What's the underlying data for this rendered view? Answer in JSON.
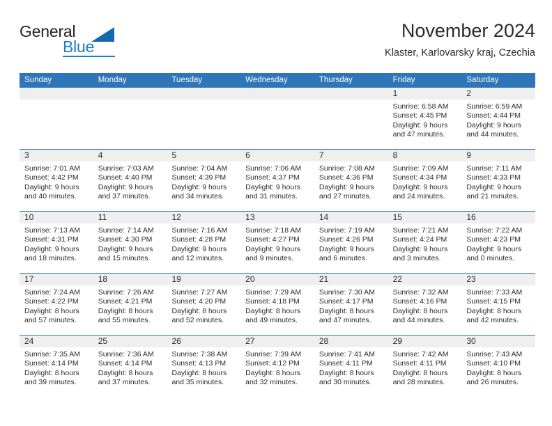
{
  "brand": {
    "word_one": "General",
    "word_two": "Blue",
    "triangle_icon": "triangle-icon",
    "accent_color": "#1c7cc4"
  },
  "header": {
    "title": "November 2024",
    "subtitle": "Klaster, Karlovarsky kraj, Czechia"
  },
  "theme": {
    "header_blue": "#2f76b8",
    "day_band_gray": "#efefef",
    "text": "#2b2b2b"
  },
  "weekdays": [
    "Sunday",
    "Monday",
    "Tuesday",
    "Wednesday",
    "Thursday",
    "Friday",
    "Saturday"
  ],
  "weeks": [
    [
      {
        "day": "",
        "empty": true,
        "sunrise": "",
        "sunset": "",
        "daylight_1": "",
        "daylight_2": ""
      },
      {
        "day": "",
        "empty": true,
        "sunrise": "",
        "sunset": "",
        "daylight_1": "",
        "daylight_2": ""
      },
      {
        "day": "",
        "empty": true,
        "sunrise": "",
        "sunset": "",
        "daylight_1": "",
        "daylight_2": ""
      },
      {
        "day": "",
        "empty": true,
        "sunrise": "",
        "sunset": "",
        "daylight_1": "",
        "daylight_2": ""
      },
      {
        "day": "",
        "empty": true,
        "sunrise": "",
        "sunset": "",
        "daylight_1": "",
        "daylight_2": ""
      },
      {
        "day": "1",
        "empty": false,
        "sunrise": "Sunrise: 6:58 AM",
        "sunset": "Sunset: 4:45 PM",
        "daylight_1": "Daylight: 9 hours",
        "daylight_2": "and 47 minutes."
      },
      {
        "day": "2",
        "empty": false,
        "sunrise": "Sunrise: 6:59 AM",
        "sunset": "Sunset: 4:44 PM",
        "daylight_1": "Daylight: 9 hours",
        "daylight_2": "and 44 minutes."
      }
    ],
    [
      {
        "day": "3",
        "empty": false,
        "sunrise": "Sunrise: 7:01 AM",
        "sunset": "Sunset: 4:42 PM",
        "daylight_1": "Daylight: 9 hours",
        "daylight_2": "and 40 minutes."
      },
      {
        "day": "4",
        "empty": false,
        "sunrise": "Sunrise: 7:03 AM",
        "sunset": "Sunset: 4:40 PM",
        "daylight_1": "Daylight: 9 hours",
        "daylight_2": "and 37 minutes."
      },
      {
        "day": "5",
        "empty": false,
        "sunrise": "Sunrise: 7:04 AM",
        "sunset": "Sunset: 4:39 PM",
        "daylight_1": "Daylight: 9 hours",
        "daylight_2": "and 34 minutes."
      },
      {
        "day": "6",
        "empty": false,
        "sunrise": "Sunrise: 7:06 AM",
        "sunset": "Sunset: 4:37 PM",
        "daylight_1": "Daylight: 9 hours",
        "daylight_2": "and 31 minutes."
      },
      {
        "day": "7",
        "empty": false,
        "sunrise": "Sunrise: 7:08 AM",
        "sunset": "Sunset: 4:36 PM",
        "daylight_1": "Daylight: 9 hours",
        "daylight_2": "and 27 minutes."
      },
      {
        "day": "8",
        "empty": false,
        "sunrise": "Sunrise: 7:09 AM",
        "sunset": "Sunset: 4:34 PM",
        "daylight_1": "Daylight: 9 hours",
        "daylight_2": "and 24 minutes."
      },
      {
        "day": "9",
        "empty": false,
        "sunrise": "Sunrise: 7:11 AM",
        "sunset": "Sunset: 4:33 PM",
        "daylight_1": "Daylight: 9 hours",
        "daylight_2": "and 21 minutes."
      }
    ],
    [
      {
        "day": "10",
        "empty": false,
        "sunrise": "Sunrise: 7:13 AM",
        "sunset": "Sunset: 4:31 PM",
        "daylight_1": "Daylight: 9 hours",
        "daylight_2": "and 18 minutes."
      },
      {
        "day": "11",
        "empty": false,
        "sunrise": "Sunrise: 7:14 AM",
        "sunset": "Sunset: 4:30 PM",
        "daylight_1": "Daylight: 9 hours",
        "daylight_2": "and 15 minutes."
      },
      {
        "day": "12",
        "empty": false,
        "sunrise": "Sunrise: 7:16 AM",
        "sunset": "Sunset: 4:28 PM",
        "daylight_1": "Daylight: 9 hours",
        "daylight_2": "and 12 minutes."
      },
      {
        "day": "13",
        "empty": false,
        "sunrise": "Sunrise: 7:18 AM",
        "sunset": "Sunset: 4:27 PM",
        "daylight_1": "Daylight: 9 hours",
        "daylight_2": "and 9 minutes."
      },
      {
        "day": "14",
        "empty": false,
        "sunrise": "Sunrise: 7:19 AM",
        "sunset": "Sunset: 4:26 PM",
        "daylight_1": "Daylight: 9 hours",
        "daylight_2": "and 6 minutes."
      },
      {
        "day": "15",
        "empty": false,
        "sunrise": "Sunrise: 7:21 AM",
        "sunset": "Sunset: 4:24 PM",
        "daylight_1": "Daylight: 9 hours",
        "daylight_2": "and 3 minutes."
      },
      {
        "day": "16",
        "empty": false,
        "sunrise": "Sunrise: 7:22 AM",
        "sunset": "Sunset: 4:23 PM",
        "daylight_1": "Daylight: 9 hours",
        "daylight_2": "and 0 minutes."
      }
    ],
    [
      {
        "day": "17",
        "empty": false,
        "sunrise": "Sunrise: 7:24 AM",
        "sunset": "Sunset: 4:22 PM",
        "daylight_1": "Daylight: 8 hours",
        "daylight_2": "and 57 minutes."
      },
      {
        "day": "18",
        "empty": false,
        "sunrise": "Sunrise: 7:26 AM",
        "sunset": "Sunset: 4:21 PM",
        "daylight_1": "Daylight: 8 hours",
        "daylight_2": "and 55 minutes."
      },
      {
        "day": "19",
        "empty": false,
        "sunrise": "Sunrise: 7:27 AM",
        "sunset": "Sunset: 4:20 PM",
        "daylight_1": "Daylight: 8 hours",
        "daylight_2": "and 52 minutes."
      },
      {
        "day": "20",
        "empty": false,
        "sunrise": "Sunrise: 7:29 AM",
        "sunset": "Sunset: 4:18 PM",
        "daylight_1": "Daylight: 8 hours",
        "daylight_2": "and 49 minutes."
      },
      {
        "day": "21",
        "empty": false,
        "sunrise": "Sunrise: 7:30 AM",
        "sunset": "Sunset: 4:17 PM",
        "daylight_1": "Daylight: 8 hours",
        "daylight_2": "and 47 minutes."
      },
      {
        "day": "22",
        "empty": false,
        "sunrise": "Sunrise: 7:32 AM",
        "sunset": "Sunset: 4:16 PM",
        "daylight_1": "Daylight: 8 hours",
        "daylight_2": "and 44 minutes."
      },
      {
        "day": "23",
        "empty": false,
        "sunrise": "Sunrise: 7:33 AM",
        "sunset": "Sunset: 4:15 PM",
        "daylight_1": "Daylight: 8 hours",
        "daylight_2": "and 42 minutes."
      }
    ],
    [
      {
        "day": "24",
        "empty": false,
        "sunrise": "Sunrise: 7:35 AM",
        "sunset": "Sunset: 4:14 PM",
        "daylight_1": "Daylight: 8 hours",
        "daylight_2": "and 39 minutes."
      },
      {
        "day": "25",
        "empty": false,
        "sunrise": "Sunrise: 7:36 AM",
        "sunset": "Sunset: 4:14 PM",
        "daylight_1": "Daylight: 8 hours",
        "daylight_2": "and 37 minutes."
      },
      {
        "day": "26",
        "empty": false,
        "sunrise": "Sunrise: 7:38 AM",
        "sunset": "Sunset: 4:13 PM",
        "daylight_1": "Daylight: 8 hours",
        "daylight_2": "and 35 minutes."
      },
      {
        "day": "27",
        "empty": false,
        "sunrise": "Sunrise: 7:39 AM",
        "sunset": "Sunset: 4:12 PM",
        "daylight_1": "Daylight: 8 hours",
        "daylight_2": "and 32 minutes."
      },
      {
        "day": "28",
        "empty": false,
        "sunrise": "Sunrise: 7:41 AM",
        "sunset": "Sunset: 4:11 PM",
        "daylight_1": "Daylight: 8 hours",
        "daylight_2": "and 30 minutes."
      },
      {
        "day": "29",
        "empty": false,
        "sunrise": "Sunrise: 7:42 AM",
        "sunset": "Sunset: 4:11 PM",
        "daylight_1": "Daylight: 8 hours",
        "daylight_2": "and 28 minutes."
      },
      {
        "day": "30",
        "empty": false,
        "sunrise": "Sunrise: 7:43 AM",
        "sunset": "Sunset: 4:10 PM",
        "daylight_1": "Daylight: 8 hours",
        "daylight_2": "and 26 minutes."
      }
    ]
  ]
}
